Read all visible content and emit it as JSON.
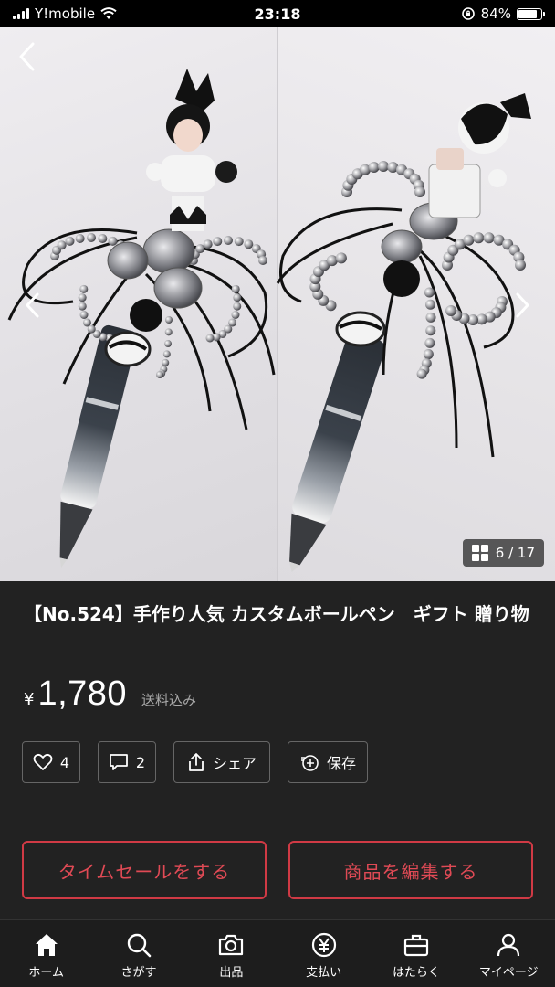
{
  "status_bar": {
    "carrier": "Y!mobile",
    "time": "23:18",
    "battery": "84%",
    "battery_level": 0.84
  },
  "gallery": {
    "counter": "6 / 17",
    "icons": [
      "back-icon",
      "chevron-left-icon",
      "chevron-right-icon",
      "grid-icon"
    ]
  },
  "product": {
    "title": "【No.524】手作り人気 カスタムボールペン　ギフト 贈り物",
    "currency": "¥",
    "price": "1,780",
    "shipping": "送料込み"
  },
  "actions": {
    "likes": "4",
    "comments": "2",
    "share": "シェア",
    "save": "保存"
  },
  "buttons": {
    "time_sale": "タイムセールをする",
    "edit": "商品を編集する",
    "accent_color": "#d03a45"
  },
  "tabbar": {
    "items": [
      {
        "label": "ホーム",
        "icon": "home-icon"
      },
      {
        "label": "さがす",
        "icon": "search-icon"
      },
      {
        "label": "出品",
        "icon": "camera-icon"
      },
      {
        "label": "支払い",
        "icon": "yen-icon"
      },
      {
        "label": "はたらく",
        "icon": "briefcase-icon"
      },
      {
        "label": "マイページ",
        "icon": "person-icon"
      }
    ]
  }
}
